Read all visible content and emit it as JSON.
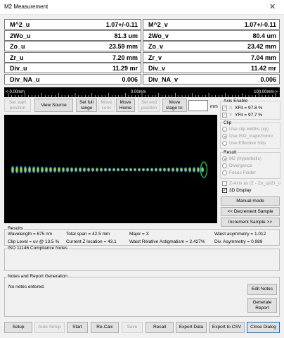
{
  "window": {
    "title": "M2 Measurement",
    "close_glyph": "✕"
  },
  "measurements_u": [
    {
      "label": "M^2_u",
      "value": "1.07+/-0.11"
    },
    {
      "label": "2Wo_u",
      "value": "81.3 um"
    },
    {
      "label": "Zo_u",
      "value": "23.59 mm"
    },
    {
      "label": "Zr_u",
      "value": "7.20 mm"
    },
    {
      "label": "Div_u",
      "value": "11.29 mr"
    },
    {
      "label": "Div_NA_u",
      "value": "0.006"
    }
  ],
  "measurements_v": [
    {
      "label": "M^2_v",
      "value": "1.07+/-0.11"
    },
    {
      "label": "2Wo_v",
      "value": "80.4 um"
    },
    {
      "label": "Zo_v",
      "value": "23.42 mm"
    },
    {
      "label": "Zr_v",
      "value": "7.04 mm"
    },
    {
      "label": "Div_v",
      "value": "11.42 mr"
    },
    {
      "label": "Div_NA_v",
      "value": "0.006"
    }
  ],
  "scale": {
    "left": "<-0.00mm",
    "center": "0.00mm",
    "right": "100.00mm->"
  },
  "toolbar": {
    "set_start": "Set start position",
    "view_source": "View Source",
    "set_full_range": "Set full range",
    "move_lens": "Move Lens",
    "move_home": "Move Home",
    "set_end": "Set end position",
    "move_stage": "Move stage to:",
    "stage_value": "",
    "stage_unit": "mm"
  },
  "axis_enable": {
    "title": "Axis Enable",
    "x_label": "X",
    "x_fit": "XFit = 97.8 %",
    "y_label": "Y",
    "y_fit": "YFit = 97.7 %"
  },
  "clip": {
    "title": "Clip",
    "options": [
      "Use clip widths (xy)",
      "Use ISO_major/minor",
      "Use Effective Slits"
    ],
    "selected_index": 1
  },
  "result": {
    "title": "Result",
    "options": [
      "M2 (Hyperbolic)",
      "Divergence",
      "Focus Finder"
    ],
    "selected_index": 0
  },
  "checks": {
    "z_axis": "Z-Axis as (Z - Zo_u)/Zr_u",
    "display_3d": "3D Display",
    "display_3d_checked": true
  },
  "side_buttons": {
    "manual": "Manual mode",
    "decrement": "<< Decrement Sample",
    "increment": "Increment Sample >>"
  },
  "results": {
    "title": "Results",
    "wavelength": "Wavelength = 675 nm",
    "total_span": "Total span = 42.5 mm",
    "major": "Major = X",
    "waist_asym": "Waist asymmetry = 1.012",
    "clip_level": "Clip Level = uv @ 13.5 %",
    "current_z": "Current Z location = 43.1",
    "waist_astig": "Waist Relative Astigmatism = 2.427%",
    "div_asym": "Div. Asymmetry = 0.989"
  },
  "iso": {
    "title": "ISO 11146 Compliance Notes",
    "text": ""
  },
  "notes": {
    "title": "Notes and Report Generation",
    "text": "No notes entered.",
    "edit_notes": "Edit Notes",
    "generate_report": "Generate Report"
  },
  "bottom_buttons": {
    "setup": "Setup",
    "auto_setup": "Auto Setup",
    "start": "Start",
    "recalc": "Re-Calc",
    "save": "Save",
    "recall": "Recall",
    "export_data": "Export Data",
    "export_csv": "Export to CSV",
    "close_dialog": "Close Dialog"
  },
  "colors": {
    "beam_bg": "#000000",
    "focus_ring": "#22dd44"
  }
}
